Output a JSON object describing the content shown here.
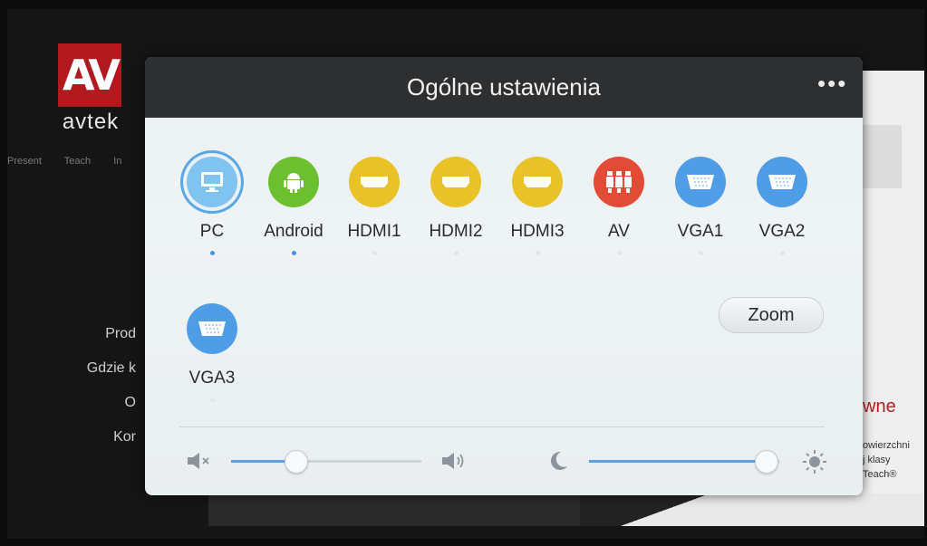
{
  "background": {
    "logo_letters": "AV",
    "logo_word": "avtek",
    "nav": [
      "Present",
      "Teach",
      "In"
    ],
    "menu": [
      "Prod",
      "Gdzie k",
      "O",
      "Kor"
    ],
    "right_heading": "wne",
    "right_text": [
      "owierzchni",
      "j klasy",
      "Teach®"
    ]
  },
  "dialog": {
    "title": "Ogólne ustawienia",
    "more_label": "•••",
    "sources": [
      {
        "label": "PC",
        "icon": "monitor-icon",
        "color": "#7fc3ee",
        "selected": true,
        "active": true
      },
      {
        "label": "Android",
        "icon": "android-icon",
        "color": "#6cbf2f",
        "selected": false,
        "active": true
      },
      {
        "label": "HDMI1",
        "icon": "hdmi-icon",
        "color": "#e8c227",
        "selected": false,
        "active": false
      },
      {
        "label": "HDMI2",
        "icon": "hdmi-icon",
        "color": "#e8c227",
        "selected": false,
        "active": false
      },
      {
        "label": "HDMI3",
        "icon": "hdmi-icon",
        "color": "#e8c227",
        "selected": false,
        "active": false
      },
      {
        "label": "AV",
        "icon": "av-rca-icon",
        "color": "#e24b35",
        "selected": false,
        "active": false
      },
      {
        "label": "VGA1",
        "icon": "vga-icon",
        "color": "#4f9de6",
        "selected": false,
        "active": false
      },
      {
        "label": "VGA2",
        "icon": "vga-icon",
        "color": "#4f9de6",
        "selected": false,
        "active": false
      },
      {
        "label": "VGA3",
        "icon": "vga-icon",
        "color": "#4f9de6",
        "selected": false,
        "active": false
      }
    ],
    "zoom_label": "Zoom",
    "volume_level": 0.34,
    "brightness_level": 0.93,
    "accent_color": "#5a9fe0"
  }
}
